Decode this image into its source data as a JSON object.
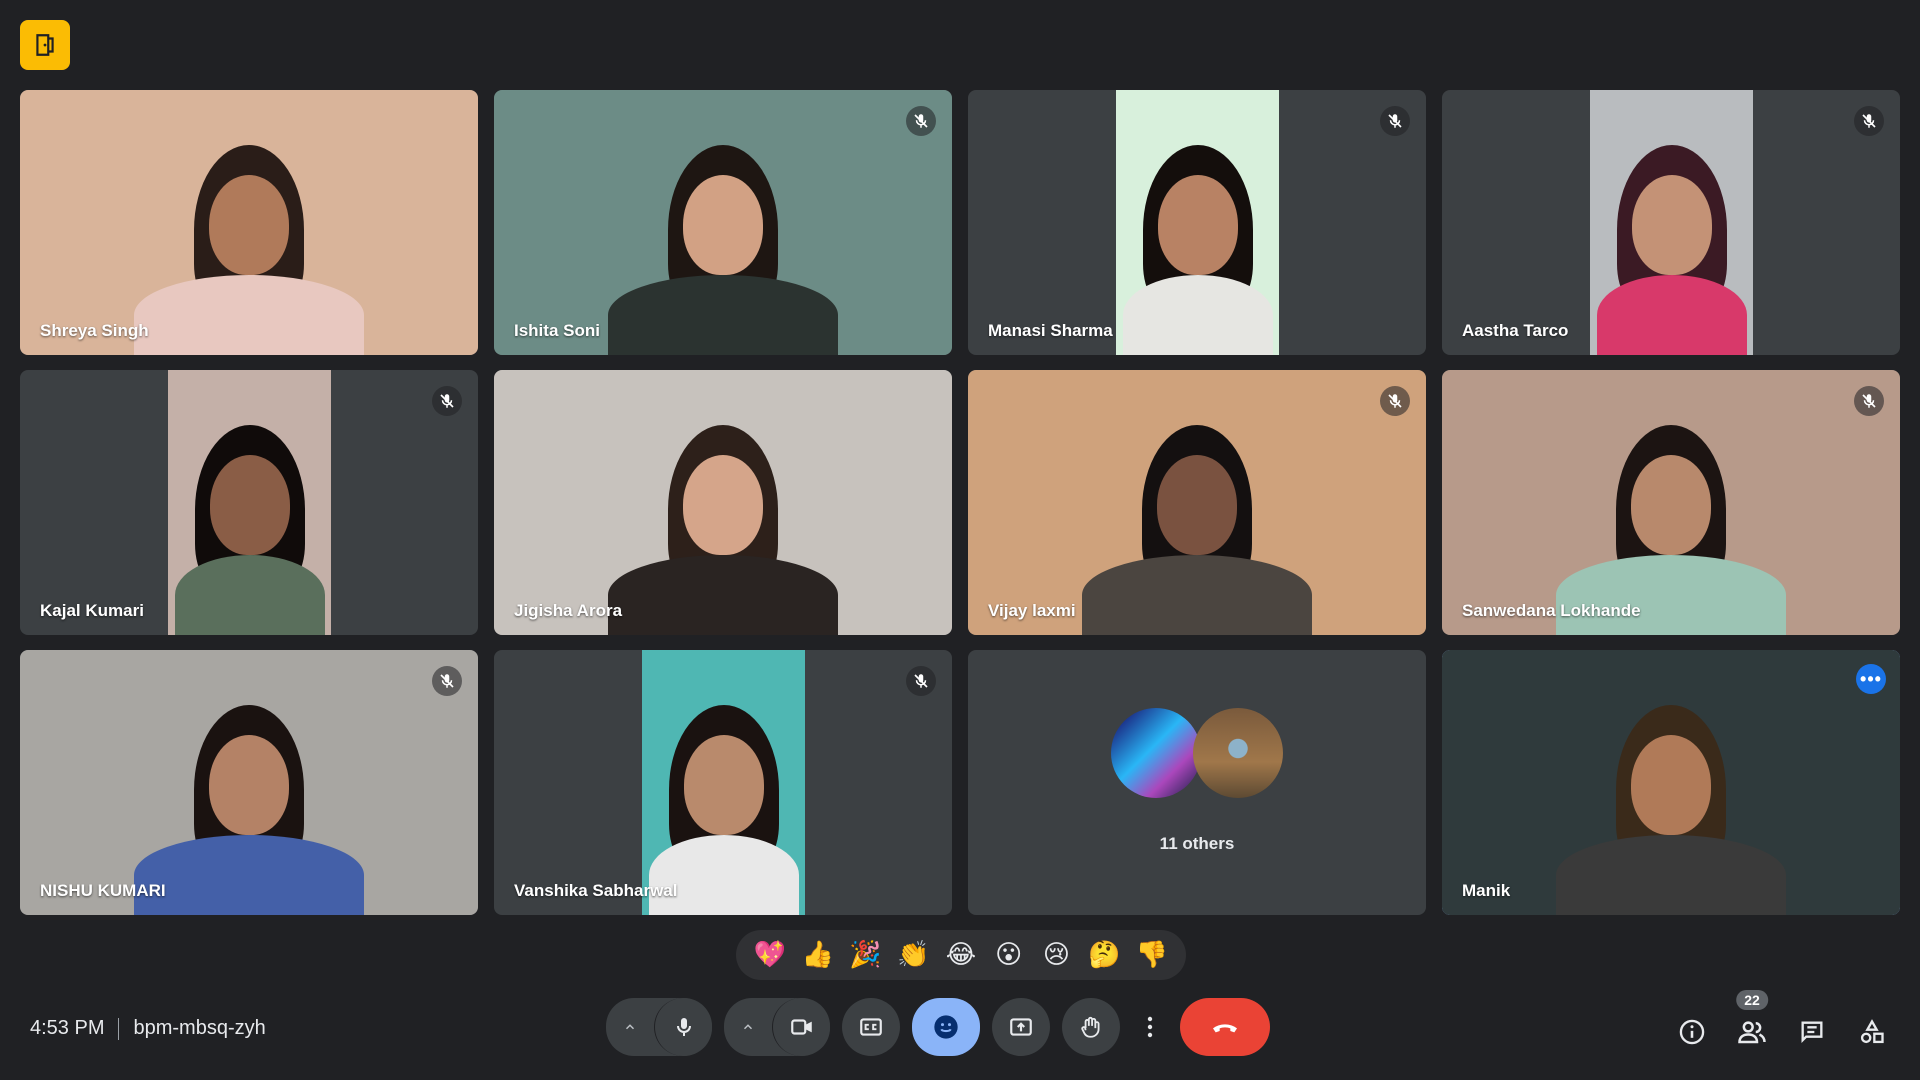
{
  "meeting": {
    "time": "4:53 PM",
    "code": "bpm-mbsq-zyh"
  },
  "participants": [
    {
      "name": "Shreya Singh",
      "muted": false,
      "bg": "#d9b49a",
      "skin": "#b07a5a",
      "hair": "#2a1d18",
      "shirt": "#e8c8c0"
    },
    {
      "name": "Ishita Soni",
      "muted": true,
      "bg": "#6c8c86",
      "skin": "#d2a184",
      "hair": "#1e1612",
      "shirt": "#2b3330"
    },
    {
      "name": "Manasi Sharma",
      "muted": true,
      "bg": "#d8f0dc",
      "skin": "#b88264",
      "hair": "#140e0c",
      "shirt": "#e6e6e2",
      "narrow": true
    },
    {
      "name": "Aastha Tarco",
      "muted": true,
      "bg": "#b9bcbf",
      "skin": "#c49276",
      "hair": "#3b1a24",
      "shirt": "#d8396a",
      "narrow": true
    },
    {
      "name": "Kajal Kumari",
      "muted": true,
      "bg": "#c4b0a8",
      "skin": "#8a5d46",
      "hair": "#100b0a",
      "shirt": "#5a6f5c",
      "narrow": true
    },
    {
      "name": "Jigisha Arora",
      "muted": false,
      "bg": "#c7c2bd",
      "skin": "#d5a58a",
      "hair": "#2d201a",
      "shirt": "#2a2422"
    },
    {
      "name": "Vijay laxmi",
      "muted": true,
      "bg": "#cfa27c",
      "skin": "#7a5240",
      "hair": "#141010",
      "shirt": "#4b4540"
    },
    {
      "name": "Sanwedana Lokhande",
      "muted": true,
      "bg": "#b79a8a",
      "skin": "#b8896c",
      "hair": "#1c1412",
      "shirt": "#9cc4b4"
    },
    {
      "name": "NISHU KUMARI",
      "muted": true,
      "bg": "#a8a6a2",
      "skin": "#b48266",
      "hair": "#1a1210",
      "shirt": "#4460a8"
    },
    {
      "name": "Vanshika Sabharwal",
      "muted": true,
      "bg": "#4fb7b3",
      "skin": "#b98a6c",
      "hair": "#1a1210",
      "shirt": "#e8e8e8",
      "narrow": true
    },
    {
      "name": "11 others",
      "others": true
    },
    {
      "name": "Manik",
      "muted": false,
      "bg": "#2f3a3c",
      "skin": "#b07a58",
      "hair": "#3a2a1a",
      "shirt": "#3a3a3a",
      "active": true
    }
  ],
  "reactions": [
    "💖",
    "👍",
    "🎉",
    "👏",
    "😂",
    "😮",
    "😢",
    "🤔",
    "👎"
  ],
  "toolbar": {
    "participant_count": "22"
  },
  "colors": {
    "background": "#202124",
    "tile": "#3c4043",
    "accent": "#8ab4f8",
    "end_call": "#ea4335",
    "logo": "#fbbc04"
  }
}
